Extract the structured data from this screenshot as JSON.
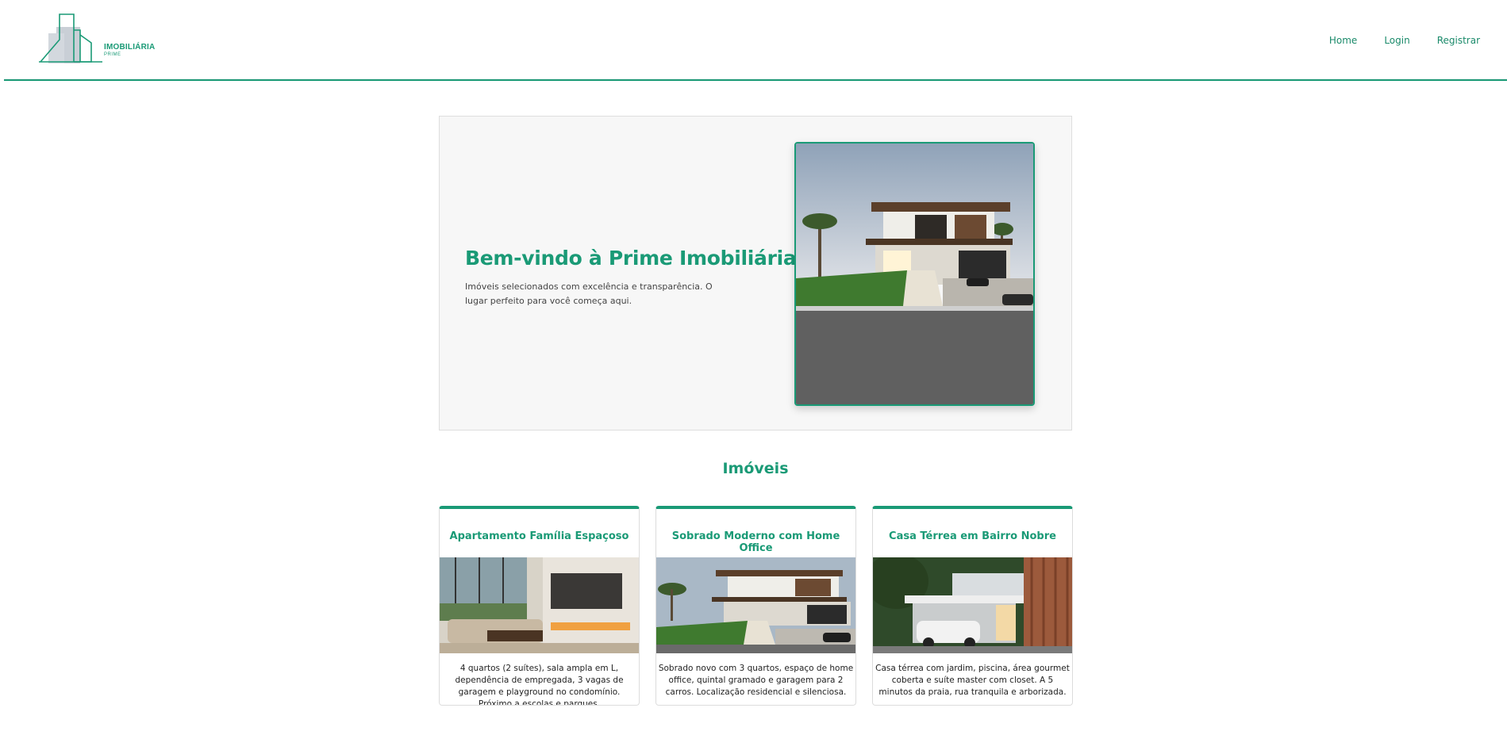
{
  "brand": {
    "name": "IMOBILIÁRIA",
    "tagline": "PRIME",
    "accent_color": "#1a9a76"
  },
  "nav": {
    "items": [
      {
        "label": "Home"
      },
      {
        "label": "Login"
      },
      {
        "label": "Registrar"
      }
    ]
  },
  "hero": {
    "title": "Bem-vindo à Prime Imobiliária!",
    "description": "Imóveis selecionados com excelência e transparência. O lugar perfeito para você começa aqui.",
    "image_icon": "modern-house-photo"
  },
  "listings": {
    "title": "Imóveis",
    "cards": [
      {
        "title": "Apartamento Família Espaçoso",
        "description": "4 quartos (2 suítes), sala ampla em L, dependência de empregada, 3 vagas de garagem e playground no condomínio. Próximo a escolas e parques.",
        "image_icon": "living-room-photo"
      },
      {
        "title": "Sobrado Moderno com Home Office",
        "description": "Sobrado novo com 3 quartos, espaço de home office, quintal gramado e garagem para 2 carros. Localização residencial e silenciosa.",
        "image_icon": "modern-house-photo"
      },
      {
        "title": "Casa Térrea em Bairro Nobre",
        "description": "Casa térrea com jardim, piscina, área gourmet coberta e suíte master com closet. A 5 minutos da praia, rua tranquila e arborizada.",
        "image_icon": "house-garage-photo"
      }
    ]
  }
}
